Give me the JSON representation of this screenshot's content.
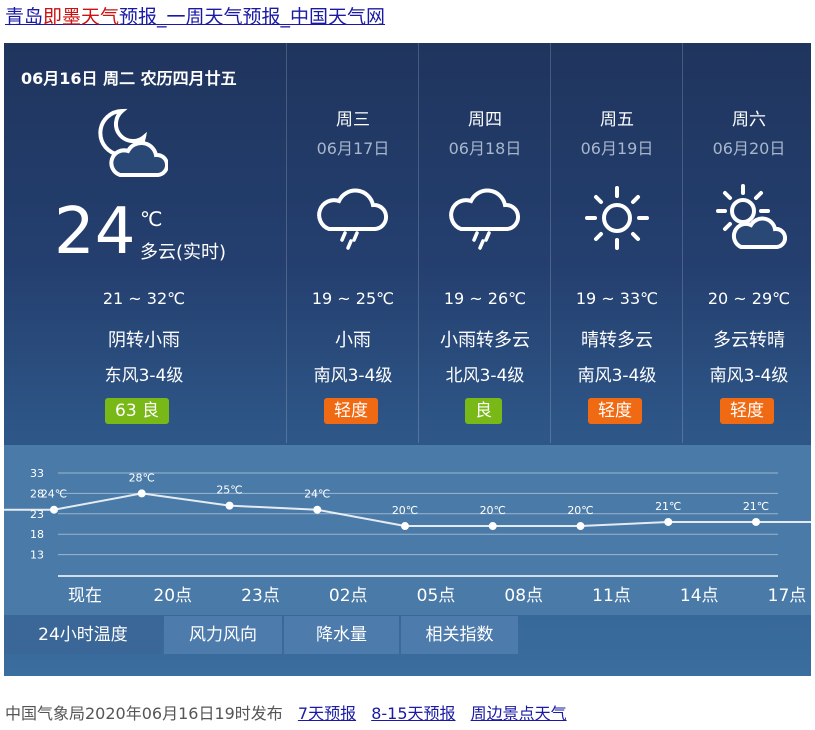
{
  "page_title": {
    "part1": "青岛",
    "part2": "即墨天气",
    "part3": "预报_一周天气预报_中国天气网"
  },
  "header": {
    "date": "06月16日 周二 农历四月廿五"
  },
  "today": {
    "icon": "moon-cloud-icon",
    "temp": "24",
    "unit": "℃",
    "condition_now": "多云(实时)",
    "range": "21 ~ 32℃",
    "condition": "阴转小雨",
    "wind": "东风3-4级",
    "aqi": "63  良",
    "aqi_color": "#79b917"
  },
  "days": [
    {
      "name": "周三",
      "date": "06月17日",
      "icon": "rain-cloud-icon",
      "range": "19 ~ 25℃",
      "condition": "小雨",
      "wind": "南风3-4级",
      "aqi": "轻度",
      "aqi_color": "#f06a13"
    },
    {
      "name": "周四",
      "date": "06月18日",
      "icon": "rain-cloud-icon",
      "range": "19 ~ 26℃",
      "condition": "小雨转多云",
      "wind": "北风3-4级",
      "aqi": "良",
      "aqi_color": "#79b917"
    },
    {
      "name": "周五",
      "date": "06月19日",
      "icon": "sun-icon",
      "range": "19 ~ 33℃",
      "condition": "晴转多云",
      "wind": "南风3-4级",
      "aqi": "轻度",
      "aqi_color": "#f06a13"
    },
    {
      "name": "周六",
      "date": "06月20日",
      "icon": "sun-cloud-icon",
      "range": "20 ~ 29℃",
      "condition": "多云转晴",
      "wind": "南风3-4级",
      "aqi": "轻度",
      "aqi_color": "#f06a13"
    }
  ],
  "chart_data": {
    "type": "line",
    "categories": [
      "现在",
      "20点",
      "23点",
      "02点",
      "05点",
      "08点",
      "11点",
      "14点",
      "17点"
    ],
    "values": [
      24,
      28,
      25,
      24,
      20,
      20,
      20,
      21,
      21
    ],
    "labels": [
      "24℃",
      "28℃",
      "25℃",
      "24℃",
      "20℃",
      "20℃",
      "20℃",
      "21℃",
      "21℃"
    ],
    "yticks": [
      "33",
      "28",
      "23",
      "18",
      "13"
    ],
    "ylim": [
      8,
      33
    ]
  },
  "tabs": [
    "24小时温度",
    "风力风向",
    "降水量",
    "相关指数"
  ],
  "footer": {
    "publish": "中国气象局2020年06月16日19时发布",
    "links": [
      "7天预报",
      "8-15天预报",
      "周边景点天气"
    ]
  }
}
